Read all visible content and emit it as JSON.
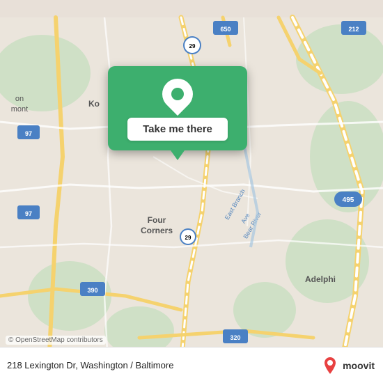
{
  "map": {
    "attribution": "© OpenStreetMap contributors",
    "background_color": "#e8e0d8"
  },
  "popup": {
    "button_label": "Take me there",
    "pin_color": "#3daf6e"
  },
  "bottom_bar": {
    "address": "218 Lexington Dr, Washington / Baltimore",
    "logo_text": "moovit"
  }
}
